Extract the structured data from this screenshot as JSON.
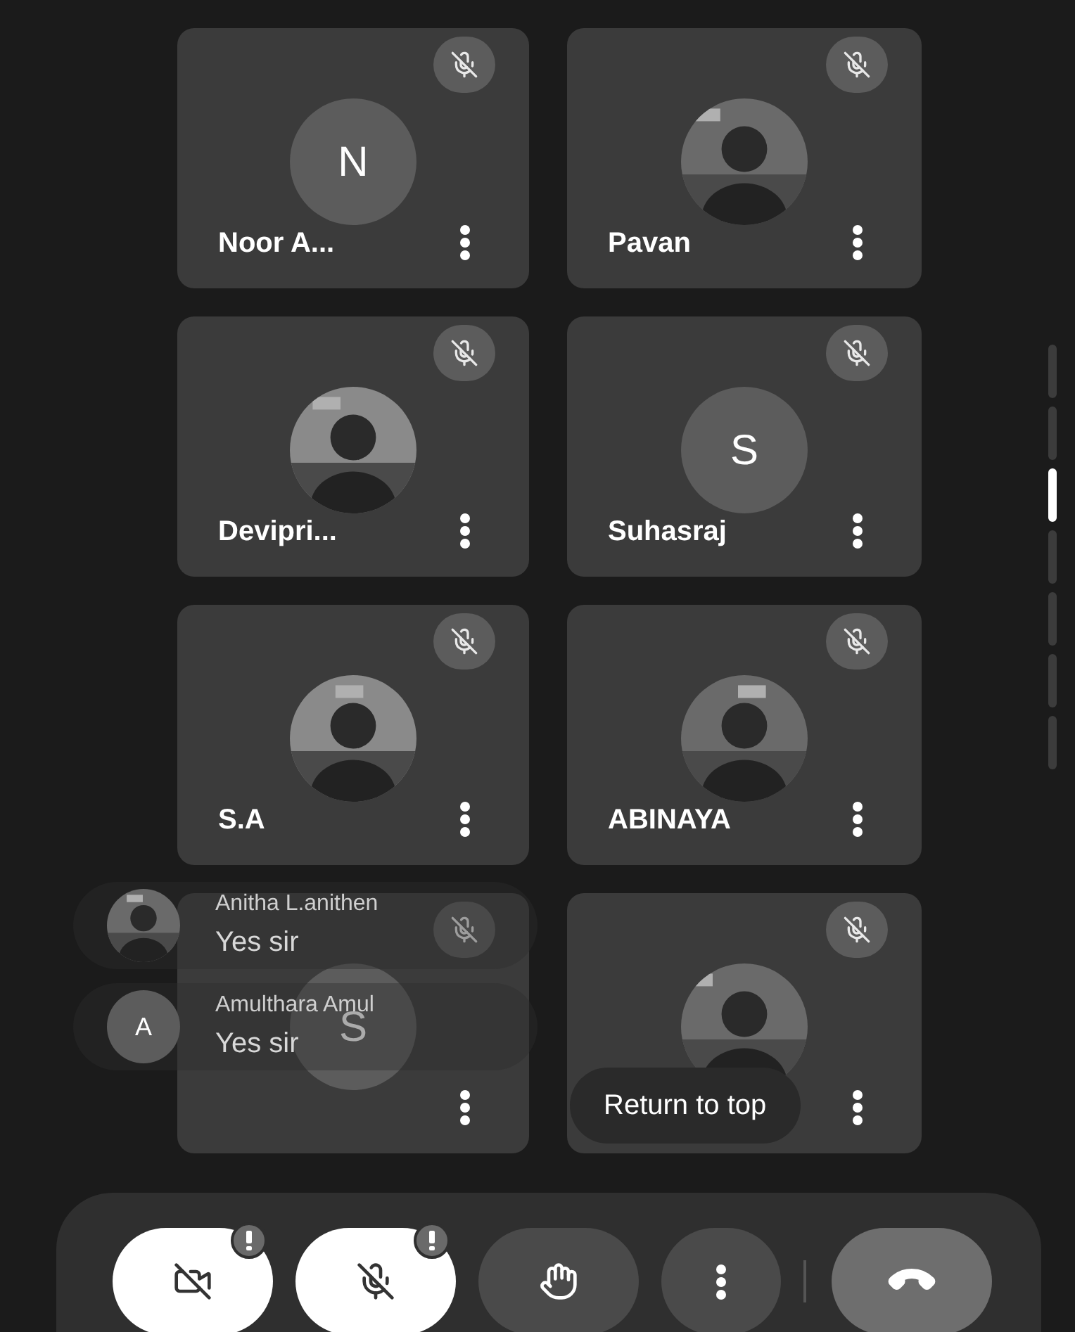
{
  "tiles": [
    {
      "name": "Noor A...",
      "avatar": {
        "kind": "letter",
        "letter": "N"
      },
      "muted": true
    },
    {
      "name": "Pavan",
      "muted": true
    },
    {
      "name": "Devipri...",
      "muted": true
    },
    {
      "name": "Suhasraj",
      "avatar": {
        "kind": "letter",
        "letter": "S"
      },
      "muted": true
    },
    {
      "name": "S.A",
      "muted": true
    },
    {
      "name": "ABINAYA",
      "muted": true
    },
    {
      "avatar": {
        "kind": "letter",
        "letter": "S"
      },
      "muted": true
    },
    {
      "muted": true
    }
  ],
  "chat_overlay": [
    {
      "sender": "Anitha L.anithen",
      "message": "Yes sir"
    },
    {
      "sender": "Amulthara Amul",
      "message": "Yes sir",
      "avatar": {
        "kind": "letter",
        "letter": "A"
      }
    }
  ],
  "return_to_top": "Return to top",
  "controls": [
    {
      "kind": "camera",
      "on": false,
      "alert": true
    },
    {
      "kind": "mic",
      "on": false,
      "alert": true
    },
    {
      "kind": "hand",
      "alert": false
    },
    {
      "kind": "more",
      "alert": false
    },
    {
      "kind": "end",
      "alert": false
    }
  ]
}
